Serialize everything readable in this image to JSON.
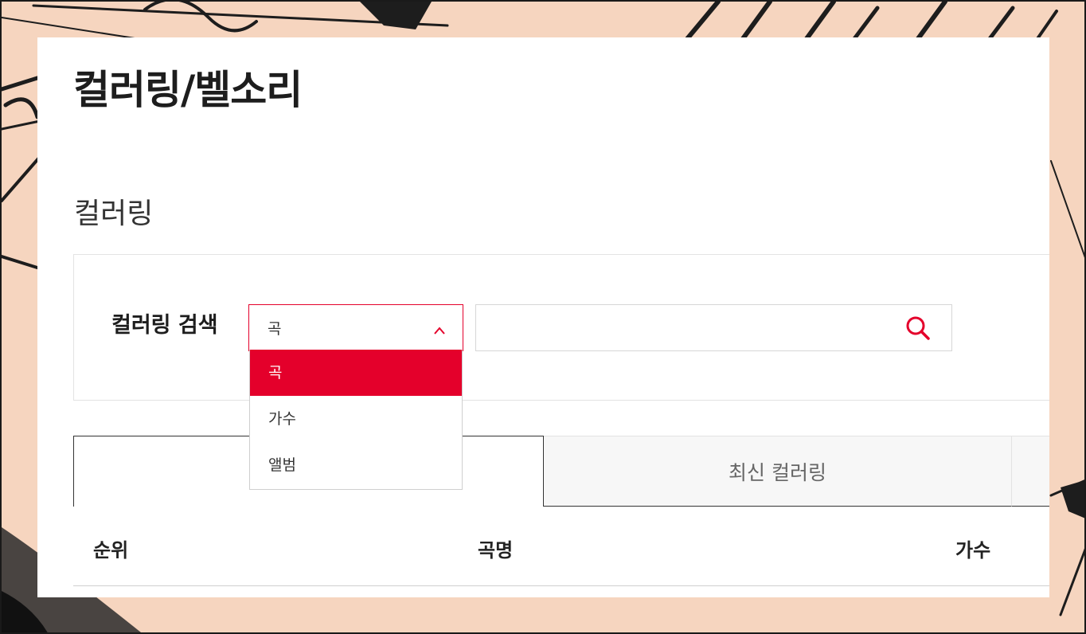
{
  "page": {
    "title": "컬러링/벨소리",
    "section_title": "컬러링"
  },
  "search": {
    "label": "컬러링 검색",
    "selected": "곡",
    "options": [
      "곡",
      "가수",
      "앨범"
    ],
    "query": "",
    "search_icon": "search-icon"
  },
  "tabs": [
    {
      "label": "",
      "active": true
    },
    {
      "label": "최신 컬러링",
      "active": false
    },
    {
      "label": "",
      "active": false
    }
  ],
  "table": {
    "columns": [
      "순위",
      "곡명",
      "가수"
    ]
  },
  "colors": {
    "accent": "#e4002b",
    "background": "#f6d5bf"
  }
}
